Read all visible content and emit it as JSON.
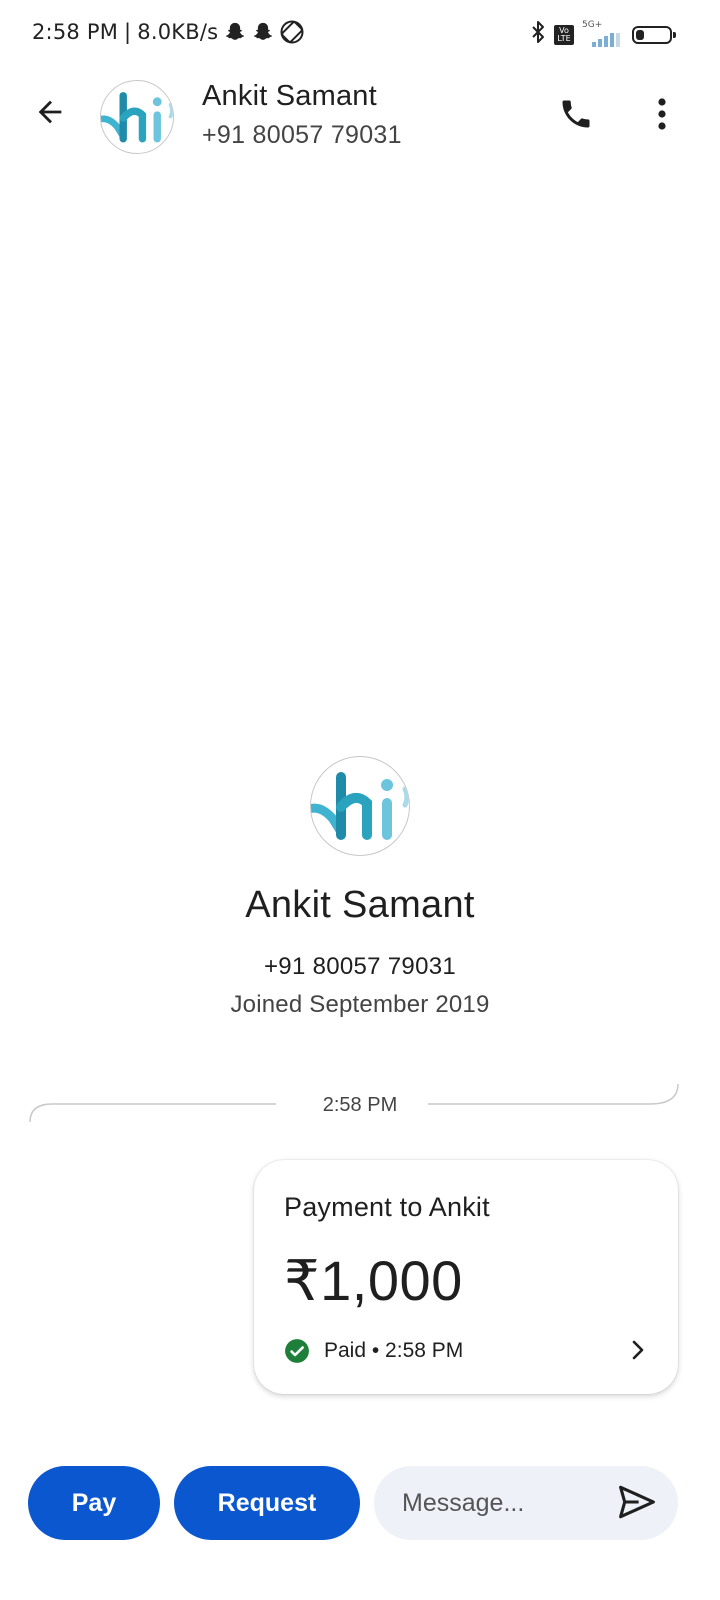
{
  "status_bar": {
    "time": "2:58 PM",
    "separator": "|",
    "net_speed": "8.0KB/s",
    "volte_label": "Vo LTE",
    "network_type": "5G+",
    "signal_level": 0.75,
    "battery_percent": "32",
    "icons": [
      "snapchat-icon",
      "snapchat-icon",
      "screen-rotate-icon",
      "bluetooth-icon",
      "volte-icon",
      "signal-icon",
      "battery-icon"
    ]
  },
  "header": {
    "contact_name": "Ankit Samant",
    "contact_phone": "+91 80057 79031",
    "avatar_text": "hi",
    "icons": [
      "back-arrow-icon",
      "phone-icon",
      "more-vertical-icon"
    ]
  },
  "profile": {
    "name": "Ankit Samant",
    "phone": "+91 80057 79031",
    "joined": "Joined September 2019",
    "avatar_text": "hi"
  },
  "conversation": {
    "timestamp": "2:58 PM",
    "payment": {
      "title": "Payment to Ankit",
      "amount": "₹1,000",
      "status": "Paid • 2:58 PM",
      "status_color": "#1e7f3a"
    }
  },
  "composer": {
    "pay_label": "Pay",
    "request_label": "Request",
    "message_placeholder": "Message...",
    "accent_color": "#0b57d0"
  }
}
